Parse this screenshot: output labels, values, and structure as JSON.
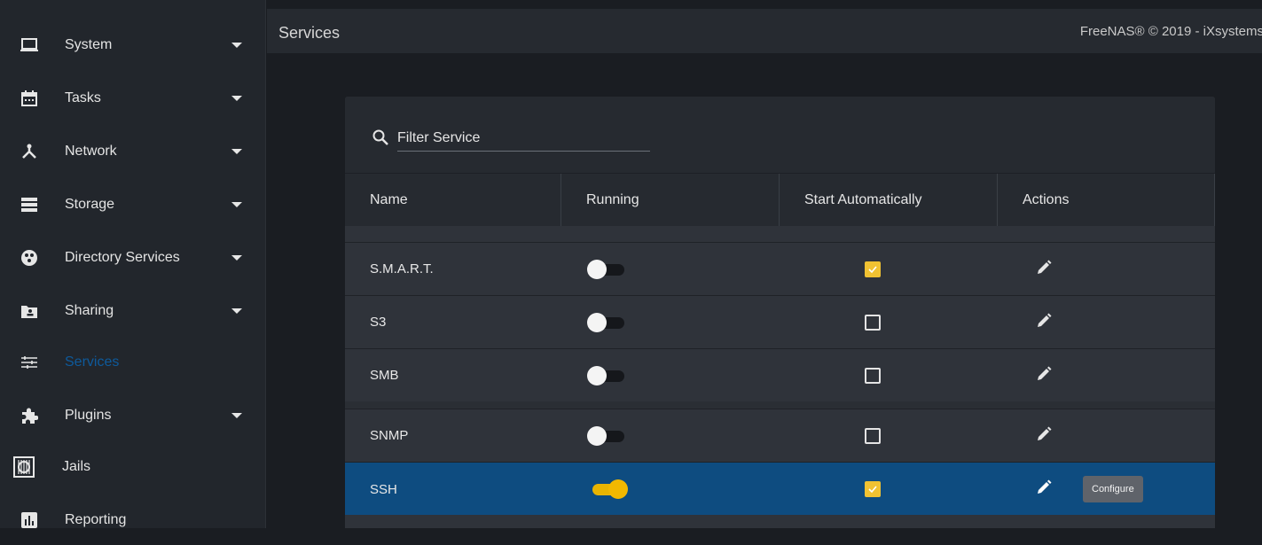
{
  "sidebar": {
    "items": [
      {
        "label": "System",
        "icon": "laptop-icon",
        "has_caret": true
      },
      {
        "label": "Tasks",
        "icon": "calendar-icon",
        "has_caret": true
      },
      {
        "label": "Network",
        "icon": "network-icon",
        "has_caret": true
      },
      {
        "label": "Storage",
        "icon": "storage-icon",
        "has_caret": true
      },
      {
        "label": "Directory Services",
        "icon": "directory-services-icon",
        "has_caret": true
      },
      {
        "label": "Sharing",
        "icon": "folder-share-icon",
        "has_caret": true
      },
      {
        "label": "Services",
        "icon": "sliders-icon",
        "has_caret": false,
        "active": true
      },
      {
        "label": "Plugins",
        "icon": "puzzle-icon",
        "has_caret": true
      },
      {
        "label": "Jails",
        "icon": "jail-icon",
        "has_caret": false
      },
      {
        "label": "Reporting",
        "icon": "chart-icon",
        "has_caret": false
      }
    ]
  },
  "header": {
    "title": "Services",
    "copyright": "FreeNAS® © 2019 - iXsystems"
  },
  "search": {
    "placeholder": "Filter Service"
  },
  "table": {
    "columns": [
      "Name",
      "Running",
      "Start Automatically",
      "Actions"
    ],
    "rows": [
      {
        "name": "S.M.A.R.T.",
        "running": false,
        "start_automatically": true
      },
      {
        "name": "S3",
        "running": false,
        "start_automatically": false
      },
      {
        "name": "SMB",
        "running": false,
        "start_automatically": false
      },
      {
        "name": "SNMP",
        "running": false,
        "start_automatically": false
      },
      {
        "name": "SSH",
        "running": true,
        "start_automatically": true,
        "selected": true
      }
    ]
  },
  "tooltip": {
    "text": "Configure"
  },
  "colors": {
    "accent_yellow": "#f1c232",
    "selected_row": "#0e4c80",
    "active_nav": "#0e5a9c"
  }
}
